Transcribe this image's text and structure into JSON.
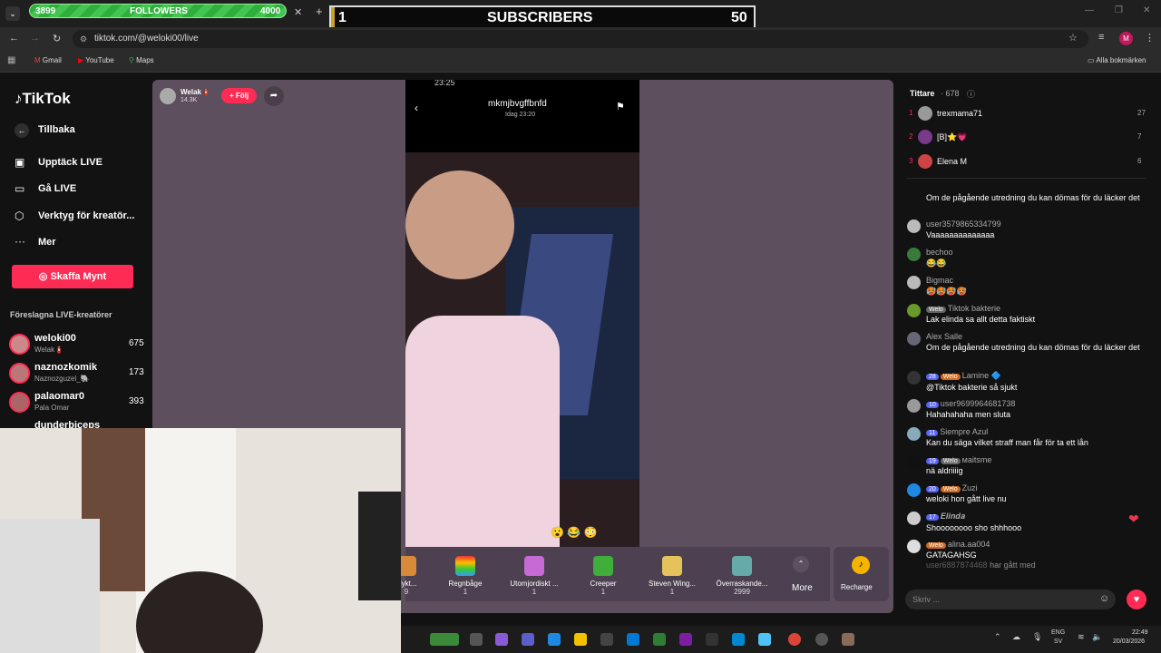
{
  "overlay": {
    "followers_current": "3899",
    "followers_label": "FOLLOWERS",
    "followers_goal": "4000",
    "followers_progress": 0.975,
    "subs_rank": "1",
    "subs_label": "SUBSCRIBERS",
    "subs_count": "50"
  },
  "browser": {
    "url": "tiktok.com/@weloki00/live",
    "bookmarks": [
      "Gmail",
      "YouTube",
      "Maps"
    ],
    "all_bookmarks": "Alla bokmärken",
    "profile_initial": "M"
  },
  "sidebar": {
    "logo": "TikTok",
    "back": "Tillbaka",
    "nav": [
      "Upptäck LIVE",
      "Gå LIVE",
      "Verktyg för kreatör...",
      "Mer"
    ],
    "coins_button": "Skaffa Mynt",
    "suggested_title": "Föreslagna LIVE-kreatörer",
    "creators": [
      {
        "name": "weloki00",
        "sub": "Welak🧯",
        "count": "675"
      },
      {
        "name": "naznozkomik",
        "sub": "Naznozguzel_🐘",
        "count": "173"
      },
      {
        "name": "palaomar0",
        "sub": "Pala Omar",
        "count": "393"
      },
      {
        "name": "dunderbiceps",
        "sub": "",
        "count": ""
      }
    ]
  },
  "stream": {
    "host_name": "Welak🧯",
    "host_likes": "14.3K",
    "follow_label": "+ Följ",
    "video_title": "mkmjbvgffbnfd",
    "video_time": "Idag 23:20",
    "video_top": "23:25"
  },
  "gifts": [
    {
      "name": "elykt...",
      "price": "9"
    },
    {
      "name": "Regnbåge",
      "price": "1"
    },
    {
      "name": "Utomjordiskt ...",
      "price": "1"
    },
    {
      "name": "Creeper",
      "price": "1"
    },
    {
      "name": "Steven Wing...",
      "price": "1"
    },
    {
      "name": "Överraskande...",
      "price": "2999"
    }
  ],
  "gift_more": "More",
  "recharge": "Recharge",
  "chat": {
    "viewers_label": "Tittare",
    "viewers_count": "· 678",
    "top": [
      {
        "rank": "1",
        "name": "trexmama71",
        "score": "27"
      },
      {
        "rank": "2",
        "name": "[B]⭐💗",
        "score": "7"
      },
      {
        "rank": "3",
        "name": "Elena M",
        "score": "6"
      }
    ],
    "messages": [
      {
        "user": "",
        "text": "Om de pågående utredning du kan dömas för du läcker det",
        "badges": []
      },
      {
        "user": "user3579865334799",
        "text": "Vaaaaaaaaaaaaaa",
        "badges": []
      },
      {
        "user": "bechoo",
        "text": "😂😂",
        "badges": []
      },
      {
        "user": "Bigmac",
        "text": "🥵🥵🥵🥵",
        "badges": []
      },
      {
        "user": "Tiktok bakterie",
        "text": "Lak elinda sa allt detta faktiskt",
        "badges": [
          "Welo"
        ]
      },
      {
        "user": "Alex Salle",
        "text": "Om de pågående utredning du kan dömas för du läcker det",
        "badges": []
      },
      {
        "user": "Lamine 🔷",
        "text": "@Tiktok bakterie så sjukt",
        "badges": [
          "28",
          "Welo"
        ]
      },
      {
        "user": "user9699964681738",
        "text": "Hahahahaha men sluta",
        "badges": [
          "10"
        ]
      },
      {
        "user": "Siempre Azul",
        "text": "Kan du säga vilket straff man får för ta ett lån",
        "badges": [
          "11"
        ]
      },
      {
        "user": "мaitsme",
        "text": "nä aldriiiig",
        "badges": [
          "19",
          "Welo"
        ]
      },
      {
        "user": "Zuzi",
        "text": "weloki hon gått live nu",
        "badges": [
          "20",
          "Welo"
        ]
      },
      {
        "user": "𝑬𝒍𝒊𝒏𝒅𝒂",
        "text": "Shoooooooo sho shhhooo",
        "badges": [
          "17"
        ]
      },
      {
        "user": "alina.aa004",
        "text": "GATAGAHSG",
        "badges": [
          "Welo"
        ]
      },
      {
        "user": "user6887874468",
        "text": "har gått med",
        "badges": []
      }
    ],
    "input_placeholder": "Skriv ..."
  },
  "taskbar": {
    "lang": "ENG",
    "lang2": "SV",
    "time": "22:49",
    "date": "20/03/2026"
  }
}
